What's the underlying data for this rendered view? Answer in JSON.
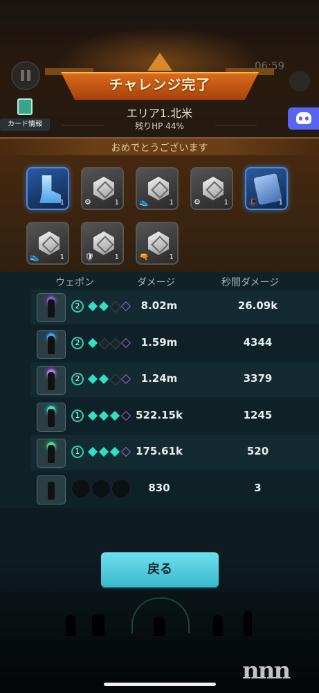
{
  "hud": {
    "timer": "06:59",
    "area_short": "エリア"
  },
  "banner": {
    "title": "チャレンジ完了"
  },
  "area": {
    "name": "エリア1.北米",
    "hp": "残りHP 44%"
  },
  "card_info": {
    "label": "カード情報"
  },
  "rewards": {
    "heading": "おめでとうございます",
    "items": [
      {
        "type": "boots",
        "count": "1",
        "rarity": "blue"
      },
      {
        "type": "gear",
        "count": "1",
        "sub_icon": "cog-icon",
        "sub": "⚙"
      },
      {
        "type": "gear",
        "count": "1",
        "sub_icon": "shoe-icon",
        "sub": "👟"
      },
      {
        "type": "gear",
        "count": "1",
        "sub_icon": "cog-icon",
        "sub": "⚙"
      },
      {
        "type": "scroll",
        "count": "1",
        "rarity": "blue",
        "sub_icon": "hat-icon",
        "sub": "🎩"
      },
      {
        "type": "gear",
        "count": "1",
        "sub_icon": "shoe-icon",
        "sub": "👟"
      },
      {
        "type": "gear",
        "count": "1",
        "sub_icon": "shield-icon",
        "sub": "🛡"
      },
      {
        "type": "gear",
        "count": "1",
        "sub_icon": "gun-icon",
        "sub": "🔫"
      }
    ]
  },
  "table": {
    "headers": {
      "weapon": "ウェポン",
      "damage": "ダメージ",
      "dps": "秒間ダメージ"
    },
    "rows": [
      {
        "level": "2",
        "stars": [
          "f",
          "f",
          "e",
          "p"
        ],
        "damage": "8.02m",
        "dps": "26.09k",
        "glow": "#8a5ad8"
      },
      {
        "level": "2",
        "stars": [
          "f",
          "e",
          "e",
          "p"
        ],
        "damage": "1.59m",
        "dps": "4344",
        "glow": "#3aa0ff"
      },
      {
        "level": "2",
        "stars": [
          "f",
          "f",
          "e",
          "p"
        ],
        "damage": "1.24m",
        "dps": "3379",
        "glow": "#c070ff"
      },
      {
        "level": "1",
        "stars": [
          "f",
          "f",
          "f",
          "p"
        ],
        "damage": "522.15k",
        "dps": "1245",
        "glow": "#30e0d0"
      },
      {
        "level": "1",
        "stars": [
          "f",
          "f",
          "f",
          "p"
        ],
        "damage": "175.61k",
        "dps": "520",
        "glow": "#40e090"
      },
      {
        "level": "",
        "stars": [],
        "damage": "830",
        "dps": "3",
        "glow": ""
      }
    ]
  },
  "back_button": {
    "label": "戻る"
  },
  "watermark": "nnn"
}
